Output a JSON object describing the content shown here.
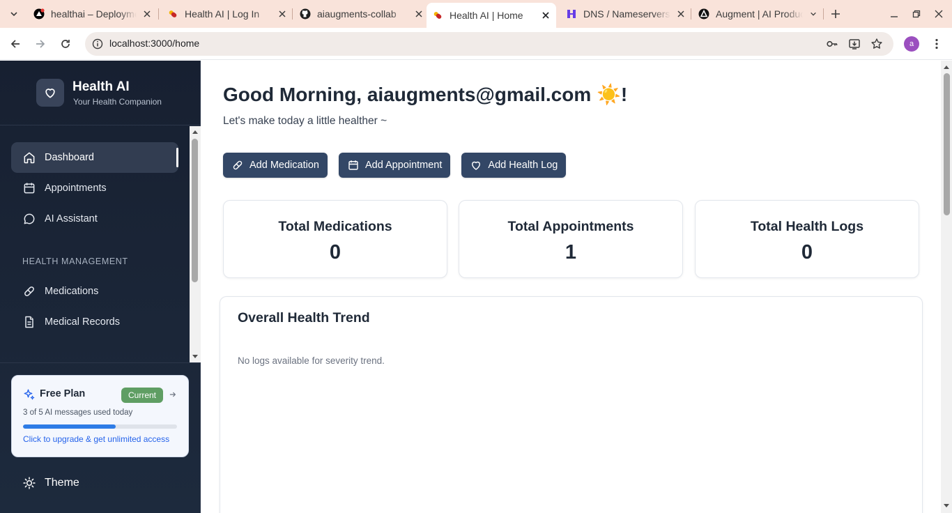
{
  "browser": {
    "tabs": [
      {
        "label": "healthai – Deployments",
        "favicon": "vercel-icon"
      },
      {
        "label": "Health AI | Log In",
        "favicon": "pill-icon"
      },
      {
        "label": "aiaugments-collab",
        "favicon": "github-icon"
      },
      {
        "label": "Health AI | Home",
        "favicon": "pill-icon",
        "active": true
      },
      {
        "label": "DNS / Nameservers",
        "favicon": "hostinger-icon"
      },
      {
        "label": "Augment | AI Product",
        "favicon": "augment-icon"
      }
    ],
    "url": "localhost:3000/home",
    "profile_initial": "a"
  },
  "sidebar": {
    "brand_name": "Health AI",
    "brand_tagline": "Your Health Companion",
    "items": [
      {
        "label": "Dashboard",
        "icon": "home-icon",
        "active": true
      },
      {
        "label": "Appointments",
        "icon": "calendar-icon"
      },
      {
        "label": "AI Assistant",
        "icon": "chat-icon"
      }
    ],
    "section_label": "HEALTH MANAGEMENT",
    "section_items": [
      {
        "label": "Medications",
        "icon": "pill-icon"
      },
      {
        "label": "Medical Records",
        "icon": "document-icon"
      }
    ],
    "plan": {
      "title": "Free Plan",
      "badge": "Current",
      "usage": "3 of 5 AI messages used today",
      "usage_fraction": 0.6,
      "upgrade": "Click to upgrade & get unlimited access"
    },
    "theme_label": "Theme"
  },
  "main": {
    "greeting": "Good Morning, aiaugments@gmail.com ☀️!",
    "subgreeting": "Let's make today a little healther ~",
    "actions": [
      {
        "label": "Add Medication",
        "icon": "pill-icon"
      },
      {
        "label": "Add Appointment",
        "icon": "calendar-icon"
      },
      {
        "label": "Add Health Log",
        "icon": "heart-icon"
      }
    ],
    "stats": [
      {
        "label": "Total Medications",
        "value": "0"
      },
      {
        "label": "Total Appointments",
        "value": "1"
      },
      {
        "label": "Total Health Logs",
        "value": "0"
      }
    ],
    "trend_title": "Overall Health Trend",
    "trend_empty": "No logs available for severity trend."
  },
  "colors": {
    "sidebar_bg": "#172031",
    "button_bg": "#334766",
    "accent_blue": "#2563eb",
    "badge_green": "#5f9e63",
    "tabbar_bg": "#f9e3da"
  }
}
